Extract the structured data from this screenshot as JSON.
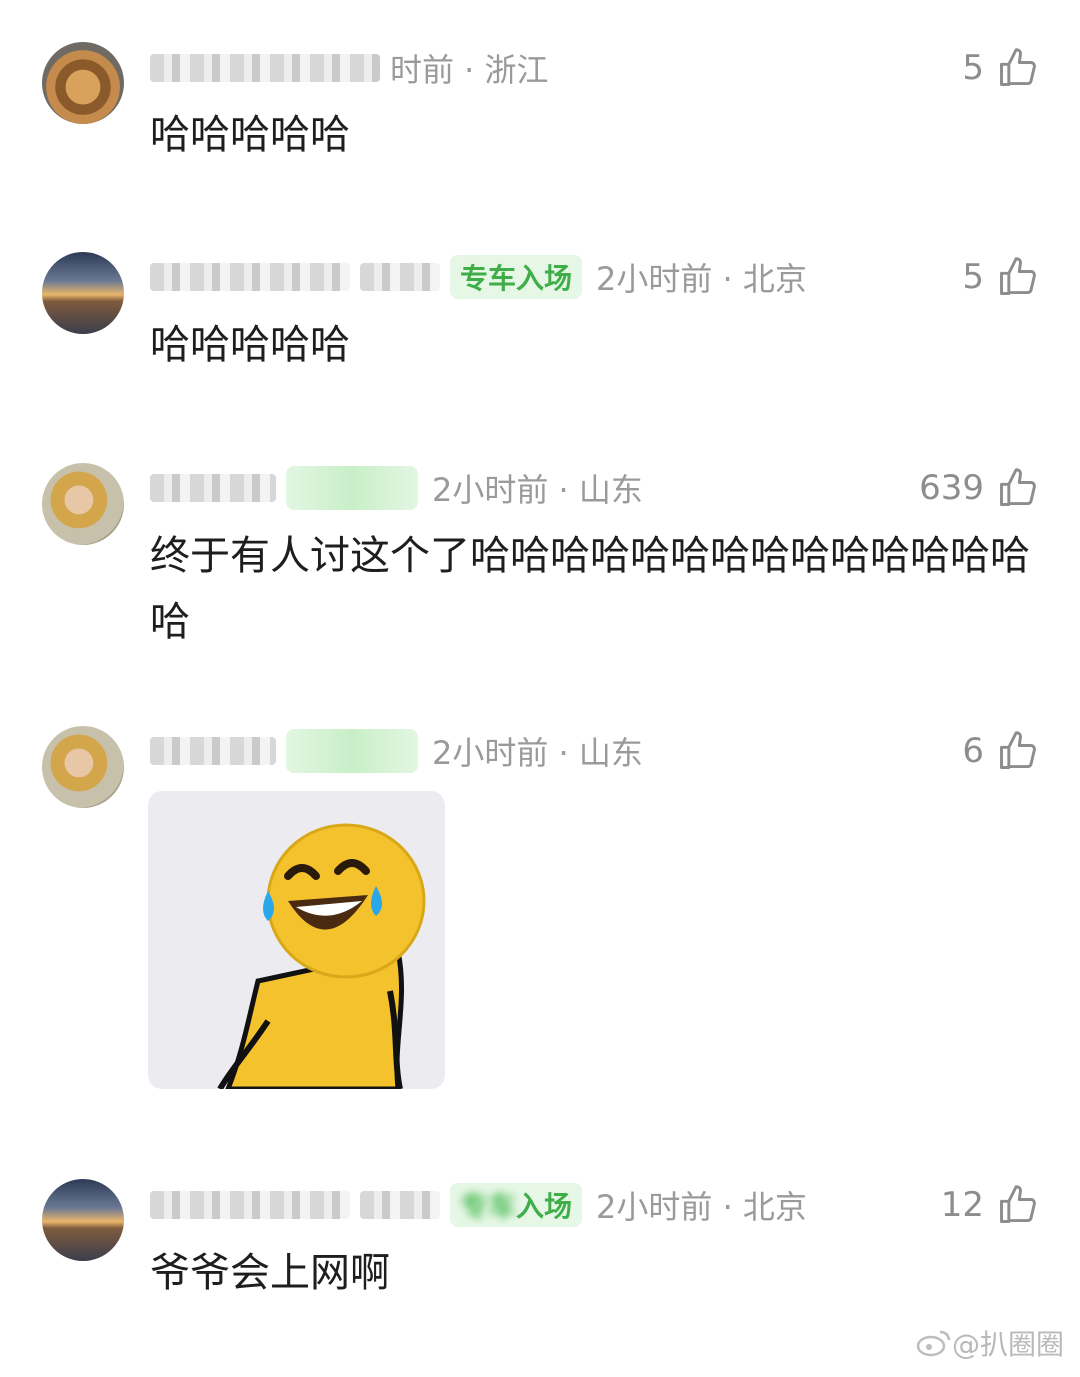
{
  "comments": [
    {
      "time_location": "时前 · 浙江",
      "likes": "5",
      "text": "哈哈哈哈哈"
    },
    {
      "badge": "专车入场",
      "time_location": "2小时前 · 北京",
      "likes": "5",
      "text": "哈哈哈哈哈"
    },
    {
      "time_location": "2小时前 · 山东",
      "likes": "639",
      "text": "终于有人讨这个了哈哈哈哈哈哈哈哈哈哈哈哈哈哈哈"
    },
    {
      "time_location": "2小时前 · 山东",
      "likes": "6"
    },
    {
      "badge": "入场",
      "time_location": "2小时前 · 北京",
      "likes": "12",
      "text": "爷爷会上网啊"
    }
  ],
  "watermark": "@扒圈圈",
  "colors": {
    "badge_green": "#3fae49",
    "meta_gray": "#9a9a9a",
    "text": "#1e1e1e"
  }
}
